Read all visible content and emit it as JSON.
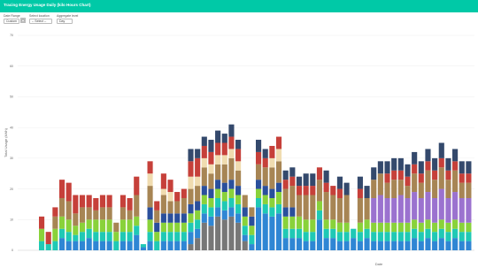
{
  "app": {
    "title": "Tracing Energy Usage Daily (kilo Hours Chart)"
  },
  "filters": [
    {
      "label": "Date Range",
      "value": "Custom"
    },
    {
      "label": "Select location",
      "value": "-- Select --"
    },
    {
      "label": "Aggregate level",
      "value": "Day"
    }
  ],
  "icons": {
    "calendar": "calendar-icon",
    "dropdown": "chevron-down-icon"
  },
  "colors": {
    "accent": "#00c9a7"
  },
  "chart_data": {
    "type": "bar",
    "stacked": true,
    "xlabel": "Date",
    "ylabel": "Total Usage (kWh)",
    "ylim": [
      0,
      70
    ],
    "yticks": [
      0,
      10,
      20,
      30,
      40,
      50,
      60,
      70
    ],
    "grid": true,
    "legend": "none",
    "series_colors": [
      "#777777",
      "#2f86d4",
      "#1fc9b5",
      "#89d23a",
      "#2a4f9c",
      "#9b72cf",
      "#a78554",
      "#f0dcb0",
      "#c6403a",
      "#34496c"
    ],
    "series_values": [
      [
        0,
        0,
        0,
        0,
        0,
        0,
        0,
        0,
        0,
        0,
        0,
        0,
        0,
        0,
        0,
        0,
        0,
        0,
        0,
        0,
        0,
        0,
        2,
        4,
        9,
        8,
        11,
        10,
        11,
        9,
        3,
        0,
        0,
        0,
        0,
        0,
        0,
        0,
        0,
        0,
        0,
        0,
        0,
        0,
        0,
        0,
        0,
        0,
        0,
        0,
        0,
        0,
        0,
        0,
        0,
        0,
        0,
        0,
        0,
        0,
        0,
        0,
        0,
        0
      ],
      [
        0,
        0,
        0,
        4,
        3,
        3,
        3,
        4,
        3,
        3,
        3,
        0,
        3,
        3,
        5,
        1,
        3,
        0,
        3,
        3,
        3,
        3,
        4,
        3,
        3,
        3,
        3,
        3,
        3,
        3,
        2,
        2,
        14,
        12,
        11,
        12,
        4,
        4,
        4,
        3,
        3,
        10,
        4,
        4,
        3,
        3,
        4,
        3,
        4,
        3,
        3,
        3,
        3,
        3,
        3,
        4,
        3,
        4,
        3,
        4,
        3,
        4,
        3,
        3
      ],
      [
        3,
        2,
        3,
        3,
        3,
        2,
        3,
        3,
        3,
        3,
        3,
        3,
        3,
        3,
        3,
        1,
        3,
        3,
        3,
        3,
        3,
        3,
        3,
        3,
        3,
        3,
        3,
        3,
        3,
        3,
        3,
        3,
        3,
        3,
        3,
        3,
        3,
        3,
        3,
        3,
        3,
        3,
        3,
        3,
        3,
        3,
        3,
        3,
        3,
        3,
        3,
        3,
        3,
        3,
        3,
        3,
        3,
        3,
        3,
        3,
        3,
        3,
        3,
        3
      ],
      [
        4,
        0,
        4,
        4,
        4,
        3,
        3,
        3,
        4,
        4,
        4,
        3,
        4,
        4,
        3,
        0,
        4,
        3,
        3,
        3,
        3,
        3,
        3,
        3,
        3,
        3,
        3,
        3,
        3,
        3,
        3,
        3,
        3,
        3,
        3,
        4,
        4,
        4,
        4,
        4,
        4,
        3,
        3,
        3,
        3,
        3,
        0,
        3,
        3,
        3,
        3,
        3,
        3,
        3,
        3,
        3,
        3,
        3,
        3,
        3,
        3,
        3,
        3,
        3
      ],
      [
        0,
        0,
        0,
        0,
        0,
        0,
        0,
        0,
        0,
        0,
        0,
        0,
        0,
        0,
        0,
        0,
        4,
        3,
        3,
        3,
        3,
        3,
        3,
        3,
        3,
        3,
        3,
        3,
        3,
        3,
        3,
        3,
        3,
        3,
        3,
        3,
        3,
        3,
        0,
        0,
        0,
        0,
        0,
        0,
        0,
        0,
        0,
        0,
        0,
        0,
        0,
        0,
        0,
        0,
        0,
        0,
        0,
        0,
        0,
        0,
        0,
        0,
        0,
        0
      ],
      [
        0,
        0,
        0,
        0,
        0,
        0,
        0,
        0,
        0,
        0,
        0,
        0,
        0,
        0,
        0,
        0,
        0,
        0,
        0,
        0,
        0,
        0,
        0,
        0,
        0,
        0,
        0,
        0,
        0,
        0,
        0,
        0,
        0,
        0,
        0,
        0,
        0,
        0,
        0,
        0,
        0,
        0,
        0,
        0,
        0,
        0,
        0,
        0,
        0,
        8,
        9,
        8,
        8,
        9,
        8,
        9,
        8,
        9,
        8,
        10,
        8,
        9,
        8,
        8
      ],
      [
        0,
        0,
        4,
        6,
        6,
        4,
        5,
        4,
        3,
        4,
        4,
        3,
        4,
        3,
        7,
        0,
        7,
        4,
        6,
        4,
        4,
        5,
        5,
        5,
        6,
        5,
        5,
        6,
        7,
        5,
        4,
        3,
        5,
        6,
        7,
        7,
        6,
        7,
        7,
        8,
        8,
        7,
        9,
        8,
        8,
        9,
        0,
        8,
        7,
        6,
        7,
        5,
        6,
        5,
        4,
        6,
        5,
        7,
        6,
        7,
        6,
        7,
        5,
        5
      ],
      [
        0,
        0,
        0,
        0,
        0,
        0,
        0,
        0,
        0,
        0,
        0,
        0,
        0,
        0,
        0,
        0,
        4,
        0,
        2,
        3,
        0,
        0,
        4,
        3,
        3,
        3,
        3,
        3,
        3,
        3,
        0,
        0,
        0,
        0,
        3,
        4,
        0,
        0,
        0,
        0,
        0,
        0,
        0,
        0,
        0,
        0,
        0,
        0,
        0,
        0,
        0,
        0,
        0,
        0,
        0,
        0,
        0,
        0,
        0,
        0,
        0,
        0,
        0,
        0
      ],
      [
        4,
        4,
        3,
        6,
        6,
        6,
        4,
        4,
        4,
        4,
        4,
        0,
        4,
        4,
        6,
        0,
        4,
        3,
        5,
        4,
        3,
        3,
        5,
        6,
        4,
        4,
        4,
        4,
        4,
        4,
        0,
        0,
        4,
        3,
        4,
        4,
        3,
        3,
        3,
        3,
        3,
        4,
        3,
        3,
        3,
        0,
        0,
        3,
        0,
        0,
        0,
        3,
        3,
        3,
        3,
        3,
        3,
        3,
        3,
        3,
        3,
        3,
        3,
        3
      ],
      [
        0,
        0,
        0,
        0,
        0,
        0,
        0,
        0,
        0,
        0,
        0,
        0,
        0,
        0,
        0,
        0,
        0,
        0,
        0,
        0,
        0,
        0,
        4,
        3,
        3,
        4,
        4,
        3,
        4,
        3,
        0,
        0,
        4,
        3,
        0,
        0,
        3,
        3,
        3,
        4,
        4,
        0,
        4,
        0,
        4,
        4,
        0,
        4,
        4,
        4,
        4,
        4,
        4,
        4,
        4,
        4,
        4,
        4,
        4,
        5,
        4,
        4,
        4,
        4
      ]
    ],
    "note_categories_unreadable": true
  }
}
